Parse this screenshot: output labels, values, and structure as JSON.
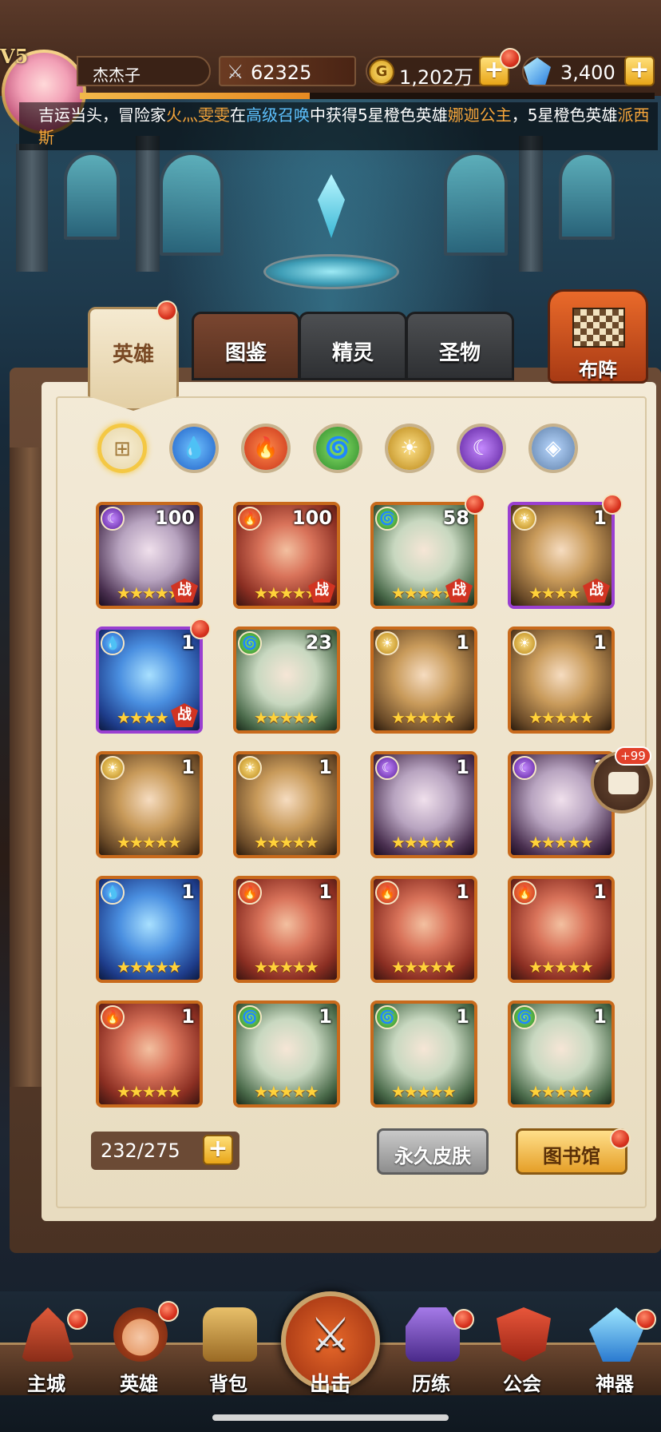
{
  "player": {
    "vip": "V5",
    "name": "杰杰子",
    "power": "62325",
    "gold": "1,202万",
    "gold_icon_letter": "G",
    "gems": "3,400"
  },
  "marquee": {
    "prefix": "吉运当头，冒险家",
    "player_name": "火灬雯雯",
    "mid1": "在",
    "event": "高级召唤",
    "mid2": "中获得5星橙色英雄",
    "hero1": "娜迦公主",
    "mid3": "，5星橙色英雄",
    "hero2": "派西斯"
  },
  "tabs": {
    "heroes": "英雄",
    "codex": "图鉴",
    "spirit": "精灵",
    "relic": "圣物",
    "formation": "布阵"
  },
  "filters": [
    "all",
    "water",
    "fire",
    "wind",
    "light",
    "dark",
    "void"
  ],
  "heroes": [
    {
      "element": "dark",
      "level": "100",
      "stars": "★★★★★",
      "battle": "战",
      "dot": false,
      "frame": "orange"
    },
    {
      "element": "fire",
      "level": "100",
      "stars": "★★★★★",
      "battle": "战",
      "dot": false,
      "frame": "orange"
    },
    {
      "element": "wind",
      "level": "58",
      "stars": "★★★★★",
      "battle": "战",
      "dot": true,
      "frame": "orange"
    },
    {
      "element": "light",
      "level": "1",
      "stars": "★★★★",
      "battle": "战",
      "dot": true,
      "frame": "purple"
    },
    {
      "element": "water",
      "level": "1",
      "stars": "★★★★",
      "battle": "战",
      "dot": true,
      "frame": "purple"
    },
    {
      "element": "wind",
      "level": "23",
      "stars": "★★★★★",
      "battle": "",
      "dot": false,
      "frame": "orange"
    },
    {
      "element": "light",
      "level": "1",
      "stars": "★★★★★",
      "battle": "",
      "dot": false,
      "frame": "orange"
    },
    {
      "element": "light",
      "level": "1",
      "stars": "★★★★★",
      "battle": "",
      "dot": false,
      "frame": "orange"
    },
    {
      "element": "light",
      "level": "1",
      "stars": "★★★★★",
      "battle": "",
      "dot": false,
      "frame": "orange"
    },
    {
      "element": "light",
      "level": "1",
      "stars": "★★★★★",
      "battle": "",
      "dot": false,
      "frame": "orange"
    },
    {
      "element": "dark",
      "level": "1",
      "stars": "★★★★★",
      "battle": "",
      "dot": false,
      "frame": "orange"
    },
    {
      "element": "dark",
      "level": "1",
      "stars": "★★★★★",
      "battle": "",
      "dot": false,
      "frame": "orange"
    },
    {
      "element": "water",
      "level": "1",
      "stars": "★★★★★",
      "battle": "",
      "dot": false,
      "frame": "orange"
    },
    {
      "element": "fire",
      "level": "1",
      "stars": "★★★★★",
      "battle": "",
      "dot": false,
      "frame": "orange"
    },
    {
      "element": "fire",
      "level": "1",
      "stars": "★★★★★",
      "battle": "",
      "dot": false,
      "frame": "orange"
    },
    {
      "element": "fire",
      "level": "1",
      "stars": "★★★★★",
      "battle": "",
      "dot": false,
      "frame": "orange"
    },
    {
      "element": "fire",
      "level": "1",
      "stars": "★★★★★",
      "battle": "",
      "dot": false,
      "frame": "orange"
    },
    {
      "element": "wind",
      "level": "1",
      "stars": "★★★★★",
      "battle": "",
      "dot": false,
      "frame": "orange"
    },
    {
      "element": "wind",
      "level": "1",
      "stars": "★★★★★",
      "battle": "",
      "dot": false,
      "frame": "orange"
    },
    {
      "element": "wind",
      "level": "1",
      "stars": "★★★★★",
      "battle": "",
      "dot": false,
      "frame": "orange"
    }
  ],
  "hero_count": "232/275",
  "buttons": {
    "skins": "永久皮肤",
    "library": "图书馆",
    "plus": "+"
  },
  "chat_badge": "+99",
  "nav": {
    "main_city": "主城",
    "heroes": "英雄",
    "bag": "背包",
    "attack": "出击",
    "trials": "历练",
    "guild": "公会",
    "artifact": "神器"
  },
  "colors": {
    "accent_orange": "#e8a518",
    "badge_red": "#d8331f",
    "highlight_orange": "#f6a53a",
    "highlight_blue": "#5ec2ff"
  }
}
